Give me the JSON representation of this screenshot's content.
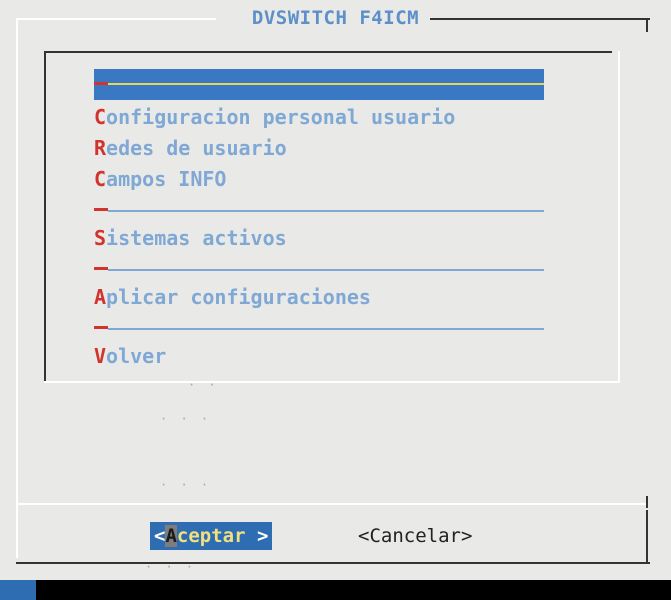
{
  "dialog": {
    "title": "DVSWITCH F4ICM"
  },
  "menu": {
    "items": [
      {
        "type": "selected"
      },
      {
        "type": "item",
        "hotkey": "C",
        "rest": "onfiguracion personal usuario"
      },
      {
        "type": "item",
        "hotkey": "R",
        "rest": "edes de usuario"
      },
      {
        "type": "item",
        "hotkey": "C",
        "rest": "ampos INFO"
      },
      {
        "type": "separator"
      },
      {
        "type": "item",
        "hotkey": "S",
        "rest": "istemas activos"
      },
      {
        "type": "separator"
      },
      {
        "type": "item",
        "hotkey": "A",
        "rest": "plicar configuraciones"
      },
      {
        "type": "separator"
      },
      {
        "type": "item",
        "hotkey": "V",
        "rest": "olver"
      }
    ]
  },
  "buttons": {
    "ok": {
      "open": "<",
      "hotkey": "A",
      "rest": "ceptar",
      "close": " >"
    },
    "cancel": {
      "label": "<Cancelar>"
    }
  },
  "colors": {
    "background": "#e9e9e7",
    "accent_blue": "#3a78c4",
    "hotkey_red": "#d2332d",
    "item_text": "#7fa8d5",
    "button_text": "#f0e080"
  }
}
